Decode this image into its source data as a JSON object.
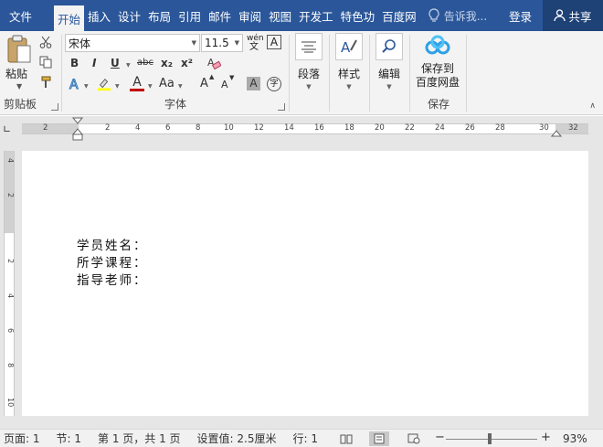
{
  "tabs": {
    "file": "文件",
    "items": [
      "开始",
      "插入",
      "设计",
      "布局",
      "引用",
      "邮件",
      "审阅",
      "视图",
      "开发工",
      "特色功",
      "百度网"
    ],
    "tell_me": "告诉我...",
    "login": "登录",
    "share": "共享"
  },
  "clipboard": {
    "paste": "粘贴",
    "label": "剪贴板"
  },
  "font": {
    "name": "宋体",
    "size": "11.5",
    "bold": "B",
    "italic": "I",
    "underline": "U",
    "strike": "abc",
    "subscript": "x₂",
    "superscript": "x²",
    "font_color_letter": "A",
    "case": "Aa",
    "grow": "A",
    "shrink": "A",
    "pinyin": "wén",
    "label": "字体"
  },
  "paragraph": {
    "label": "段落"
  },
  "styles": {
    "label": "样式"
  },
  "editing": {
    "label": "编辑"
  },
  "baidu": {
    "line1": "保存到",
    "line2": "百度网盘",
    "label": "保存"
  },
  "ruler": {
    "h_numbers": [
      "2",
      "2",
      "4",
      "6",
      "8",
      "10",
      "12",
      "14",
      "16",
      "18",
      "20",
      "22",
      "24",
      "26",
      "28",
      "30",
      "32"
    ],
    "v_numbers": [
      "4",
      "2",
      "2",
      "4",
      "6",
      "8",
      "10"
    ]
  },
  "document": {
    "lines": [
      "学员姓名：",
      "所学课程：",
      "指导老师："
    ]
  },
  "status": {
    "page": "页面: 1",
    "section": "节: 1",
    "pages": "第 1 页，共 1 页",
    "setting": "设置值: 2.5厘米",
    "line": "行: 1",
    "zoom": "93%",
    "minus": "−",
    "plus": "+"
  },
  "colors": {
    "accent": "#2b579a",
    "highlight": "#ffff00",
    "font_color": "#c00000"
  }
}
